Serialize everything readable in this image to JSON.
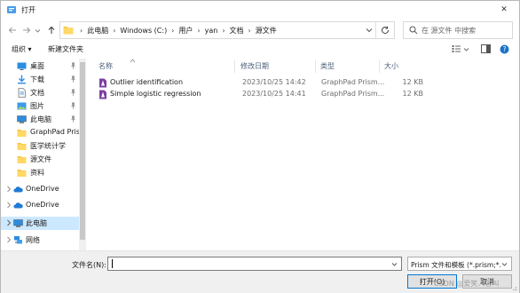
{
  "window": {
    "title": "打开",
    "close_glyph": "✕"
  },
  "nav": {
    "breadcrumb": [
      "此电脑",
      "Windows (C:)",
      "用户",
      "yan",
      "文档",
      "源文件"
    ],
    "search_placeholder": "在 源文件 中搜索"
  },
  "toolbar": {
    "organize_label": "组织 ▾",
    "new_folder_label": "新建文件夹"
  },
  "sidebar": {
    "items": [
      {
        "label": "桌面",
        "icon": "desktop-icon",
        "pinned": true
      },
      {
        "label": "下载",
        "icon": "download-icon",
        "pinned": true
      },
      {
        "label": "文档",
        "icon": "document-icon",
        "pinned": true
      },
      {
        "label": "图片",
        "icon": "picture-icon",
        "pinned": true
      },
      {
        "label": "此电脑",
        "icon": "computer-icon",
        "pinned": true
      },
      {
        "label": "GraphPad Prism",
        "icon": "folder-icon",
        "pinned": false
      },
      {
        "label": "医学统计学",
        "icon": "folder-icon",
        "pinned": false
      },
      {
        "label": "源文件",
        "icon": "folder-icon",
        "pinned": false
      },
      {
        "label": "资料",
        "icon": "folder-icon",
        "pinned": false
      },
      {
        "label": "OneDrive",
        "icon": "cloud-icon",
        "pinned": false
      },
      {
        "label": "OneDrive",
        "icon": "cloud-icon",
        "pinned": false
      },
      {
        "label": "此电脑",
        "icon": "computer-icon",
        "pinned": false
      },
      {
        "label": "网络",
        "icon": "network-icon",
        "pinned": false
      }
    ]
  },
  "columns": {
    "name": "名称",
    "date": "修改日期",
    "type": "类型",
    "size": "大小"
  },
  "files": [
    {
      "name": "Outlier identification",
      "date": "2023/10/25 14:42",
      "type": "GraphPad Prism...",
      "size": "12 KB"
    },
    {
      "name": "Simple logistic regression",
      "date": "2023/10/25 14:41",
      "type": "GraphPad Prism...",
      "size": "12 KB"
    }
  ],
  "bottom": {
    "filename_label": "文件名(N):",
    "filename_value": "",
    "filetype_value": "Prism 文件和模板 (*.prism;*.p",
    "open_label": "打开(O)",
    "cancel_label": "取消",
    "watermark": "CSDN @爱笑人名叫"
  },
  "colors": {
    "accent": "#0078d7",
    "folder": "#f5c342",
    "prism_file": "#7b3fa0",
    "selected_bg": "#cce8ff"
  }
}
